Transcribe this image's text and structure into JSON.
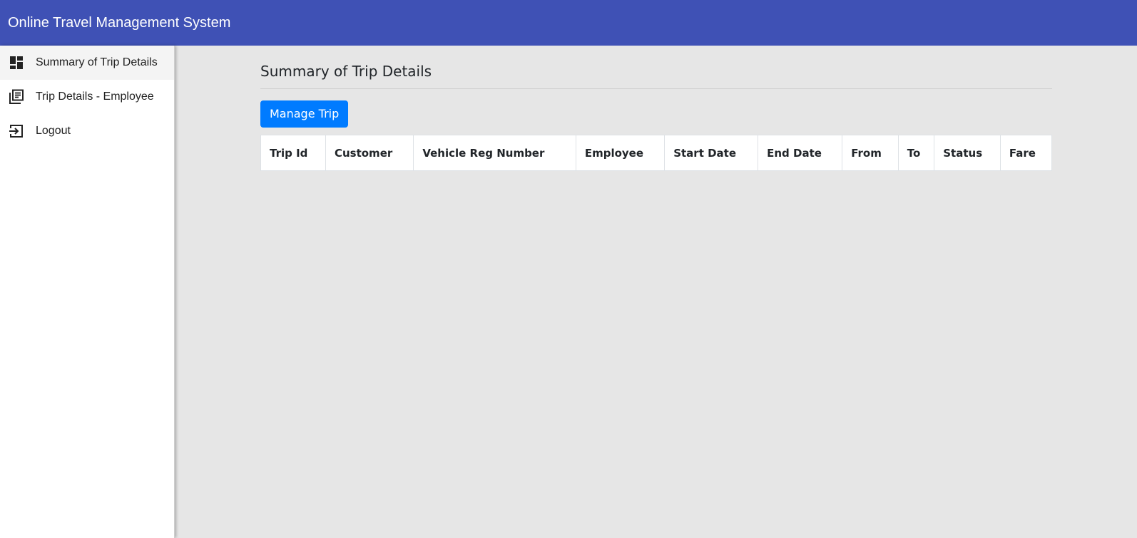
{
  "app": {
    "title": "Online Travel Management System",
    "brand_color": "#3f51b5"
  },
  "sidebar": {
    "items": [
      {
        "label": "Summary of Trip Details",
        "icon": "dashboard-icon",
        "active": true
      },
      {
        "label": "Trip Details - Employee",
        "icon": "library-books-icon",
        "active": false
      },
      {
        "label": "Logout",
        "icon": "logout-icon",
        "active": false
      }
    ]
  },
  "main": {
    "title": "Summary of Trip Details",
    "manage_button_label": "Manage Trip",
    "button_color": "#007bff",
    "table": {
      "columns": [
        "Trip Id",
        "Customer",
        "Vehicle Reg Number",
        "Employee",
        "Start Date",
        "End Date",
        "From",
        "To",
        "Status",
        "Fare"
      ],
      "rows": []
    }
  }
}
